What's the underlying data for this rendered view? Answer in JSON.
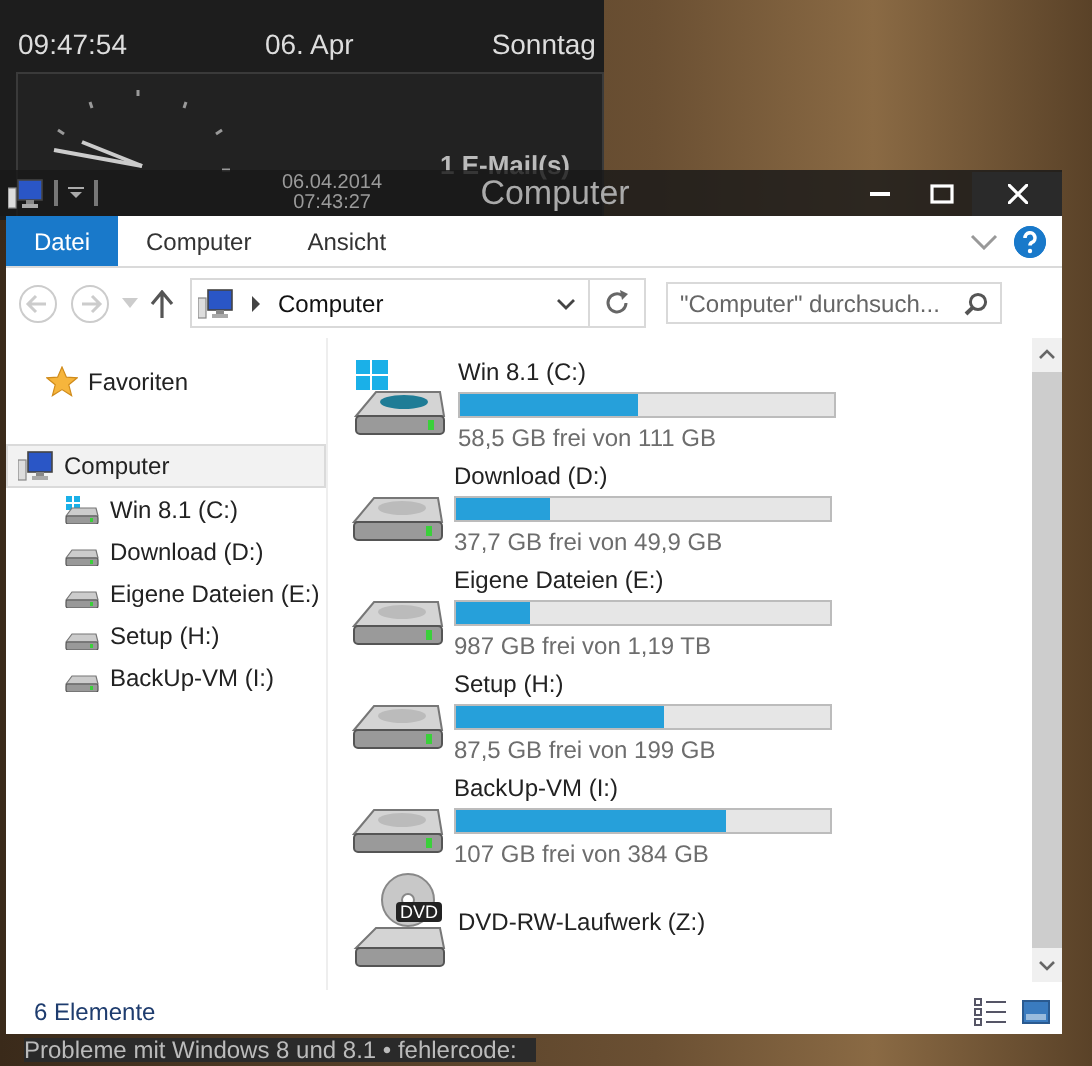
{
  "gadget": {
    "time": "09:47:54",
    "date": "06. Apr",
    "weekday": "Sonntag",
    "mail": "1 E-Mail(s)",
    "last_date": "06.04.2014",
    "last_time": "07:43:27"
  },
  "window": {
    "title": "Computer"
  },
  "ribbon_tabs": [
    {
      "label": "Datei",
      "selected": true
    },
    {
      "label": "Computer",
      "selected": false
    },
    {
      "label": "Ansicht",
      "selected": false
    }
  ],
  "address_bar": {
    "location": "Computer"
  },
  "search": {
    "placeholder": "\"Computer\" durchsuch..."
  },
  "sidebar": {
    "favorites": "Favoriten",
    "items": [
      {
        "label": "Computer",
        "kind": "computer",
        "selected": true,
        "children": [
          {
            "label": "Win 8.1 (C:)",
            "kind": "system",
            "selected": false
          },
          {
            "label": "Download (D:)",
            "kind": "hdd",
            "selected": false
          },
          {
            "label": "Eigene Dateien (E:)",
            "kind": "hdd",
            "selected": false
          },
          {
            "label": "Setup (H:)",
            "kind": "hdd",
            "selected": false
          },
          {
            "label": "BackUp-VM (I:)",
            "kind": "hdd",
            "selected": false
          }
        ]
      }
    ]
  },
  "drives": [
    {
      "name": "Win 8.1 (C:)",
      "kind": "system",
      "level": 0.476,
      "free": "58,5 GB frei von 111 GB"
    },
    {
      "name": "Download (D:)",
      "kind": "hdd",
      "level": 0.253,
      "free": "37,7 GB frei von 49,9 GB"
    },
    {
      "name": "Eigene Dateien (E:)",
      "kind": "hdd",
      "level": 0.2,
      "free": "987 GB frei von 1,19 TB"
    },
    {
      "name": "Setup (H:)",
      "kind": "hdd",
      "level": 0.554,
      "free": "87,5 GB frei von 199 GB"
    },
    {
      "name": "BackUp-VM (I:)",
      "kind": "hdd",
      "level": 0.72,
      "free": "107 GB frei von 384 GB"
    },
    {
      "name": "DVD-RW-Laufwerk (Z:)",
      "kind": "dvd",
      "dvd_label": "DVD"
    }
  ],
  "status_bar": {
    "count": "6 Elemente"
  },
  "background_text": "Probleme mit Windows 8 und 8.1 • fehlercode:"
}
